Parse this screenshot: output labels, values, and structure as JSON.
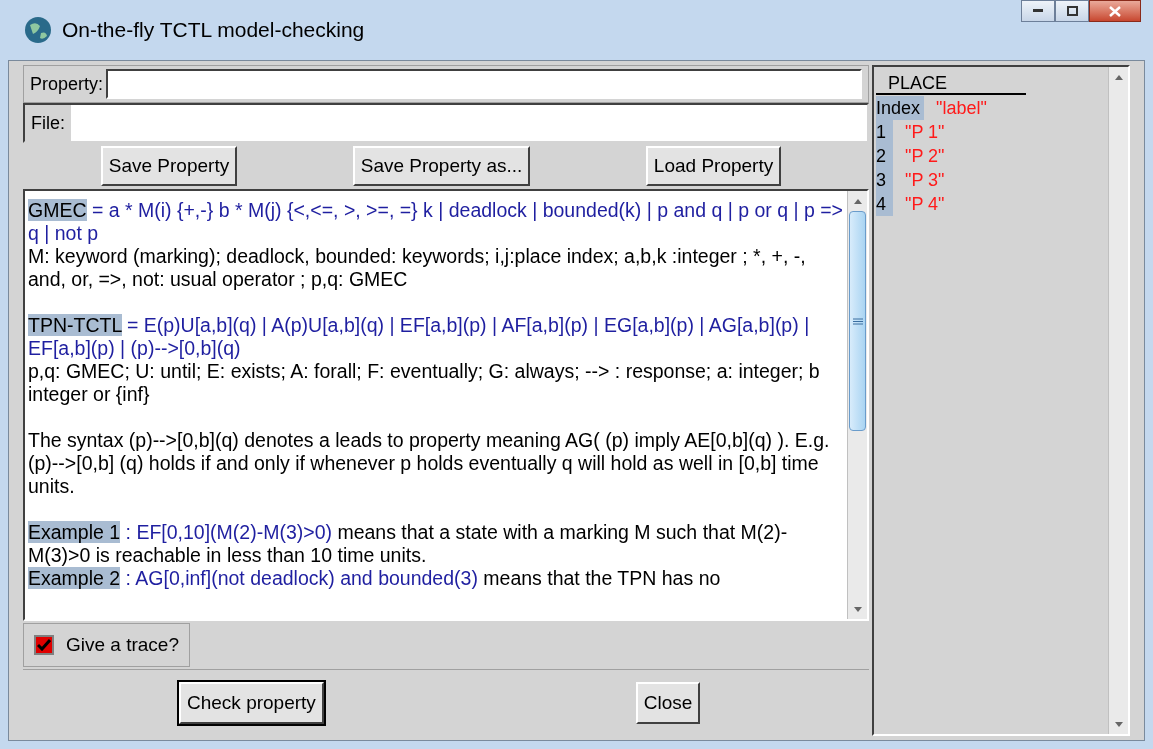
{
  "window": {
    "title": "On-the-fly TCTL model-checking"
  },
  "property_field": {
    "label": "Property:"
  },
  "file_field": {
    "label": "File:"
  },
  "file_buttons": [
    "Save Property",
    "Save Property as...",
    "Load Property"
  ],
  "help_sections": [
    [
      [
        {
          "kind": "term",
          "text": "GMEC"
        },
        {
          "kind": "formula",
          "text": " = a * M(i) {+,-} b * M(j) {<,<=, >, >=, =} k | deadlock | bounded(k) | p and q | p or q | p => q | not p"
        }
      ],
      [
        {
          "kind": "plain",
          "text": "M: keyword (marking); deadlock, bounded: keywords; i,j:place index; a,b,k :integer ; *, +, -, and, or, =>, not: usual operator ; p,q: GMEC"
        }
      ]
    ],
    [
      [
        {
          "kind": "term",
          "text": "TPN-TCTL"
        },
        {
          "kind": "formula",
          "text": " = E(p)U[a,b](q) | A(p)U[a,b](q) | EF[a,b](p) | AF[a,b](p) | EG[a,b](p) | AG[a,b](p) | EF[a,b](p) | (p)-->[0,b](q)"
        }
      ],
      [
        {
          "kind": "plain",
          "text": "p,q: GMEC; U: until; E: exists; A: forall; F: eventually; G: always; --> : response; a: integer; b integer or {inf}"
        }
      ]
    ],
    [
      [
        {
          "kind": "plain",
          "text": "The syntax (p)-->[0,b](q) denotes a leads to property meaning AG( (p) imply AE[0,b](q) ). E.g. (p)-->[0,b] (q) holds if and only if whenever p holds eventually q will hold as well in [0,b] time units."
        }
      ]
    ],
    [
      [
        {
          "kind": "term",
          "text": "Example 1"
        },
        {
          "kind": "formula",
          "text": " : EF[0,10](M(2)-M(3)>0)"
        },
        {
          "kind": "plain",
          "text": " means that a state with a marking M such that M(2)-M(3)>0 is reachable in less than 10 time units."
        }
      ],
      [
        {
          "kind": "term",
          "text": "Example 2"
        },
        {
          "kind": "formula",
          "text": " : AG[0,inf](not deadlock) and bounded(3)"
        },
        {
          "kind": "plain",
          "text": " means that the TPN has no"
        }
      ]
    ]
  ],
  "trace_checkbox": {
    "label": "Give a trace?",
    "checked": true
  },
  "action_buttons": [
    {
      "label": "Check property",
      "default": true
    },
    {
      "label": "Close",
      "default": false
    }
  ],
  "place_table": {
    "title": "PLACE",
    "header": {
      "index": "Index",
      "label": "\"label\""
    },
    "rows": [
      {
        "index": "1",
        "label": "\"P 1\""
      },
      {
        "index": "2",
        "label": "\"P 2\""
      },
      {
        "index": "3",
        "label": "\"P 3\""
      },
      {
        "index": "4",
        "label": "\"P 4\""
      }
    ]
  }
}
